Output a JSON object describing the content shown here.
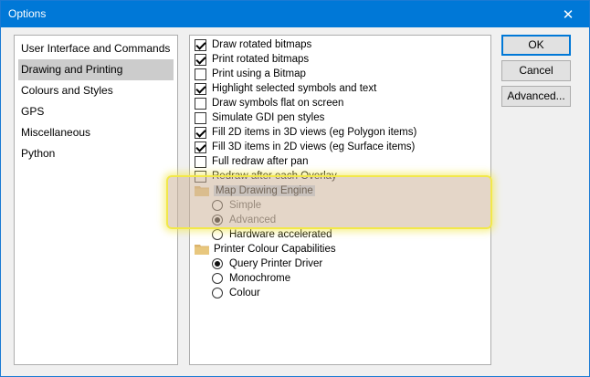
{
  "window": {
    "title": "Options"
  },
  "categories": [
    {
      "label": "User Interface and Commands"
    },
    {
      "label": "Drawing and Printing"
    },
    {
      "label": "Colours and Styles"
    },
    {
      "label": "GPS"
    },
    {
      "label": "Miscellaneous"
    },
    {
      "label": "Python"
    }
  ],
  "settings": {
    "checkboxes": [
      {
        "label": "Draw rotated bitmaps",
        "checked": true
      },
      {
        "label": "Print rotated bitmaps",
        "checked": true
      },
      {
        "label": "Print using a Bitmap",
        "checked": false
      },
      {
        "label": "Highlight selected symbols and text",
        "checked": true
      },
      {
        "label": "Draw symbols flat on screen",
        "checked": false
      },
      {
        "label": "Simulate GDI pen styles",
        "checked": false
      },
      {
        "label": "Fill 2D items in 3D views (eg Polygon items)",
        "checked": true
      },
      {
        "label": "Fill 3D items in 2D views (eg Surface items)",
        "checked": true
      },
      {
        "label": "Full redraw after pan",
        "checked": false
      },
      {
        "label": "Redraw after each Overlay",
        "checked": false
      }
    ],
    "map_engine": {
      "group_label": "Map Drawing Engine",
      "options": [
        {
          "label": "Simple",
          "checked": false
        },
        {
          "label": "Advanced",
          "checked": true
        },
        {
          "label": "Hardware accelerated",
          "checked": false
        }
      ]
    },
    "printer_colour": {
      "group_label": "Printer Colour Capabilities",
      "options": [
        {
          "label": "Query Printer Driver",
          "checked": true
        },
        {
          "label": "Monochrome",
          "checked": false
        },
        {
          "label": "Colour",
          "checked": false
        }
      ]
    }
  },
  "buttons": {
    "ok": "OK",
    "cancel": "Cancel",
    "advanced": "Advanced..."
  },
  "icons": {
    "close": "close-icon",
    "folder": "folder-icon"
  },
  "colors": {
    "titlebar": "#0078d7",
    "highlight_border": "#f2e84a",
    "selected_item": "#cccccc"
  }
}
